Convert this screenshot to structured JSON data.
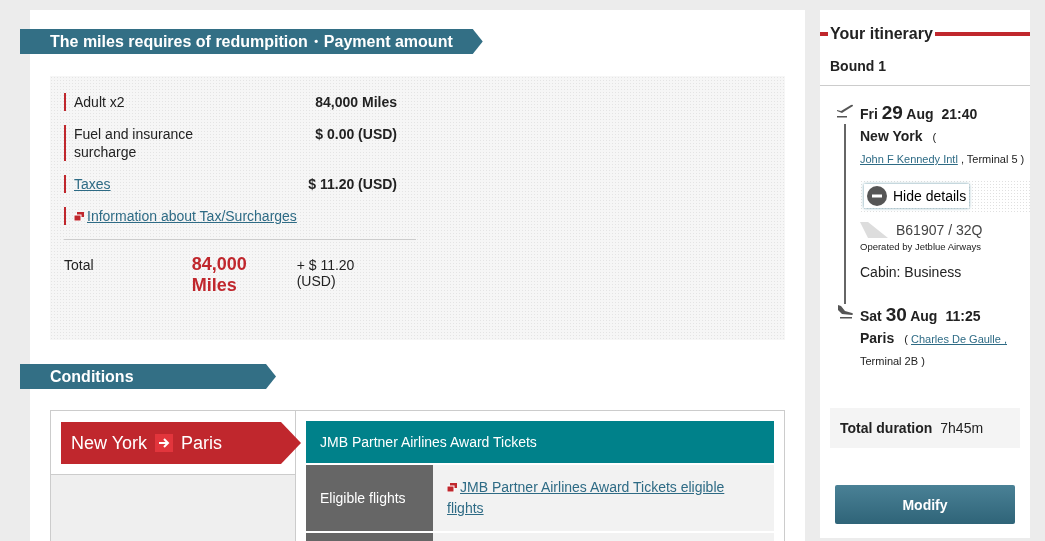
{
  "payment": {
    "title": "The miles requires of redumpition・Payment amount",
    "rows": [
      {
        "kind": "text",
        "label": "Adult x2",
        "value": "84,000 Miles"
      },
      {
        "kind": "text",
        "label": "Fuel and insurance surcharge",
        "value": "$ 0.00 (USD)"
      },
      {
        "kind": "link",
        "label": "Taxes",
        "value": "$ 11.20 (USD)"
      },
      {
        "kind": "info_link",
        "label": "Information about Tax/Surcharges"
      }
    ],
    "total": {
      "label": "Total",
      "miles": "84,000 Miles",
      "cash": "+ $ 11.20 (USD)"
    }
  },
  "conditions": {
    "title": "Conditions",
    "route": {
      "from": "New York",
      "to": "Paris"
    },
    "fare_name": "JMB Partner Airlines Award Tickets",
    "rows": [
      {
        "label": "Eligible flights",
        "link": "JMB Partner Airlines Award Tickets eligible flights"
      }
    ]
  },
  "itinerary": {
    "title": "Your itinerary",
    "bound": "Bound 1",
    "segments": [
      {
        "kind": "departure",
        "weekday": "Fri",
        "day": "29",
        "month": "Aug",
        "time": "21:40",
        "city": "New York",
        "open": "(",
        "airport": "John F Kennedy Intl",
        "after": ", Terminal 5 )"
      },
      {
        "kind": "arrival",
        "weekday": "Sat",
        "day": "30",
        "month": "Aug",
        "time": "11:25",
        "city": "Paris",
        "open": "(",
        "airport": "Charles De Gaulle ,",
        "after": "Terminal 2B )"
      }
    ],
    "details_button": "Hide details",
    "flight": "B61907  /  32Q",
    "operated_by": "Operated by Jetblue Airways",
    "cabin": "Cabin: Business",
    "total_duration": {
      "label": "Total duration",
      "value": "7h45m"
    },
    "button": "Modify"
  }
}
